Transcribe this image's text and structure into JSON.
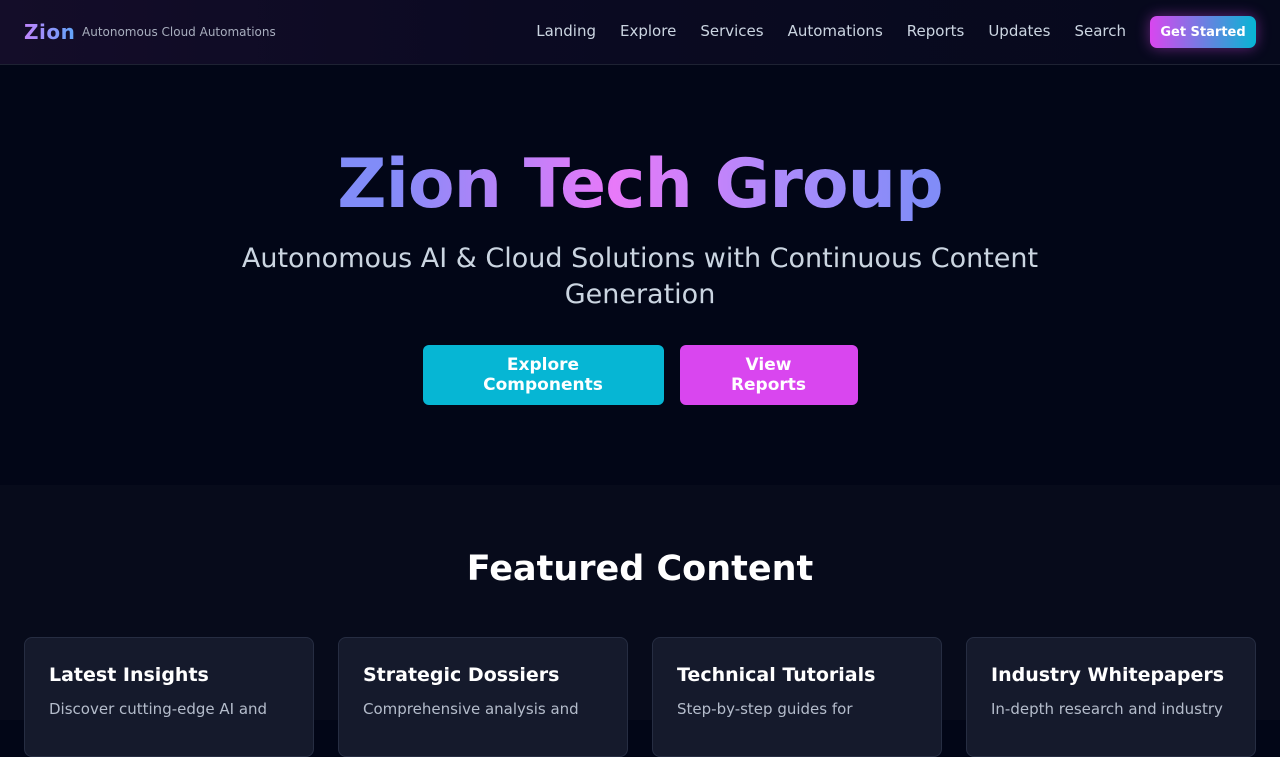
{
  "nav": {
    "brand": "Zion",
    "tagline": "Autonomous Cloud Automations",
    "links": [
      "Landing",
      "Explore",
      "Services",
      "Automations",
      "Reports",
      "Updates",
      "Search"
    ],
    "cta_label": "Get Started"
  },
  "hero": {
    "title": "Zion Tech Group",
    "subtitle": "Autonomous AI & Cloud Solutions with Continuous Content Generation",
    "primary_button": "Explore Components",
    "secondary_button": "View Reports"
  },
  "featured": {
    "heading": "Featured Content",
    "cards": [
      {
        "title": "Latest Insights",
        "description": "Discover cutting-edge AI and"
      },
      {
        "title": "Strategic Dossiers",
        "description": "Comprehensive analysis and"
      },
      {
        "title": "Technical Tutorials",
        "description": "Step-by-step guides for"
      },
      {
        "title": "Industry Whitepapers",
        "description": "In-depth research and industry"
      }
    ]
  },
  "colors": {
    "accent_cyan": "#06b6d4",
    "accent_magenta": "#d946ef",
    "background": "#020617",
    "card_background": "#151a2c"
  }
}
